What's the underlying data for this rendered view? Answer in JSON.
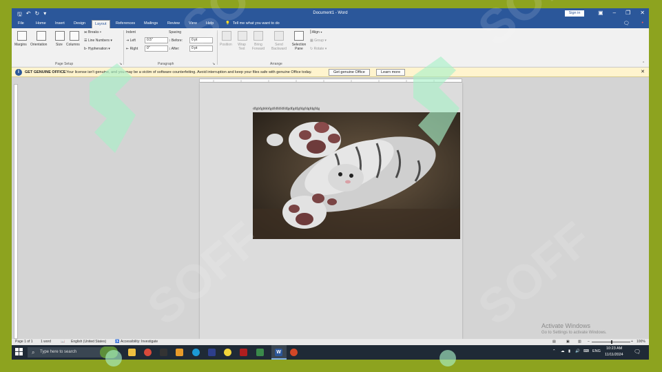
{
  "window": {
    "title": "Document1  -  Word",
    "signin_label": "Sign in"
  },
  "tabs": [
    {
      "label": "File",
      "active": false
    },
    {
      "label": "Home",
      "active": false
    },
    {
      "label": "Insert",
      "active": false
    },
    {
      "label": "Design",
      "active": false
    },
    {
      "label": "Layout",
      "active": true
    },
    {
      "label": "References",
      "active": false
    },
    {
      "label": "Mailings",
      "active": false
    },
    {
      "label": "Review",
      "active": false
    },
    {
      "label": "View",
      "active": false
    },
    {
      "label": "Help",
      "active": false
    }
  ],
  "tell_me": "Tell me what you want to do",
  "ribbon": {
    "page_setup": {
      "margins": "Margins",
      "orientation": "Orientation",
      "size": "Size",
      "columns": "Columns",
      "breaks": "Breaks",
      "line_numbers": "Line Numbers",
      "hyphenation": "Hyphenation",
      "group_label": "Page Setup"
    },
    "paragraph": {
      "indent_label": "Indent",
      "spacing_label": "Spacing",
      "left_label": "Left",
      "right_label": "Right",
      "before_label": "Before:",
      "after_label": "After:",
      "left_value": "0.5\"",
      "right_value": "0\"",
      "before_value": "0 pt",
      "after_value": "0 pt",
      "group_label": "Paragraph"
    },
    "arrange": {
      "position": "Position",
      "wrap_text": "Wrap Text",
      "bring_forward": "Bring Forward",
      "send_backward": "Send Backward",
      "selection_pane": "Selection Pane",
      "align": "Align",
      "group": "Group",
      "rotate": "Rotate",
      "group_label": "Arrange"
    }
  },
  "message_bar": {
    "title": "GET GENUINE OFFICE",
    "text": "Your license isn't genuine, and you may be a victim of software counterfeiting. Avoid interruption and keep your files safe with genuine Office today.",
    "primary_button": "Get genuine Office",
    "secondary_button": "Learn more"
  },
  "document": {
    "text": "dfgbfgbbbfgdfdfdfdfdfgdfgdfgfdgfdgfdgfdg"
  },
  "activation": {
    "title": "Activate Windows",
    "subtitle": "Go to Settings to activate Windows."
  },
  "status": {
    "page": "Page 1 of 1",
    "words": "1 word",
    "language": "English (United States)",
    "accessibility": "Accessibility: Investigate",
    "zoom": "100%"
  },
  "taskbar": {
    "search_placeholder": "Type here to search",
    "lang": "ENG",
    "time": "10:23 AM",
    "date": "11/11/2024"
  },
  "colors": {
    "word_blue": "#2b579a",
    "frame_green": "#8da31f",
    "watermark_green": "#a8f0c8",
    "message_bar": "#fff4ce"
  }
}
